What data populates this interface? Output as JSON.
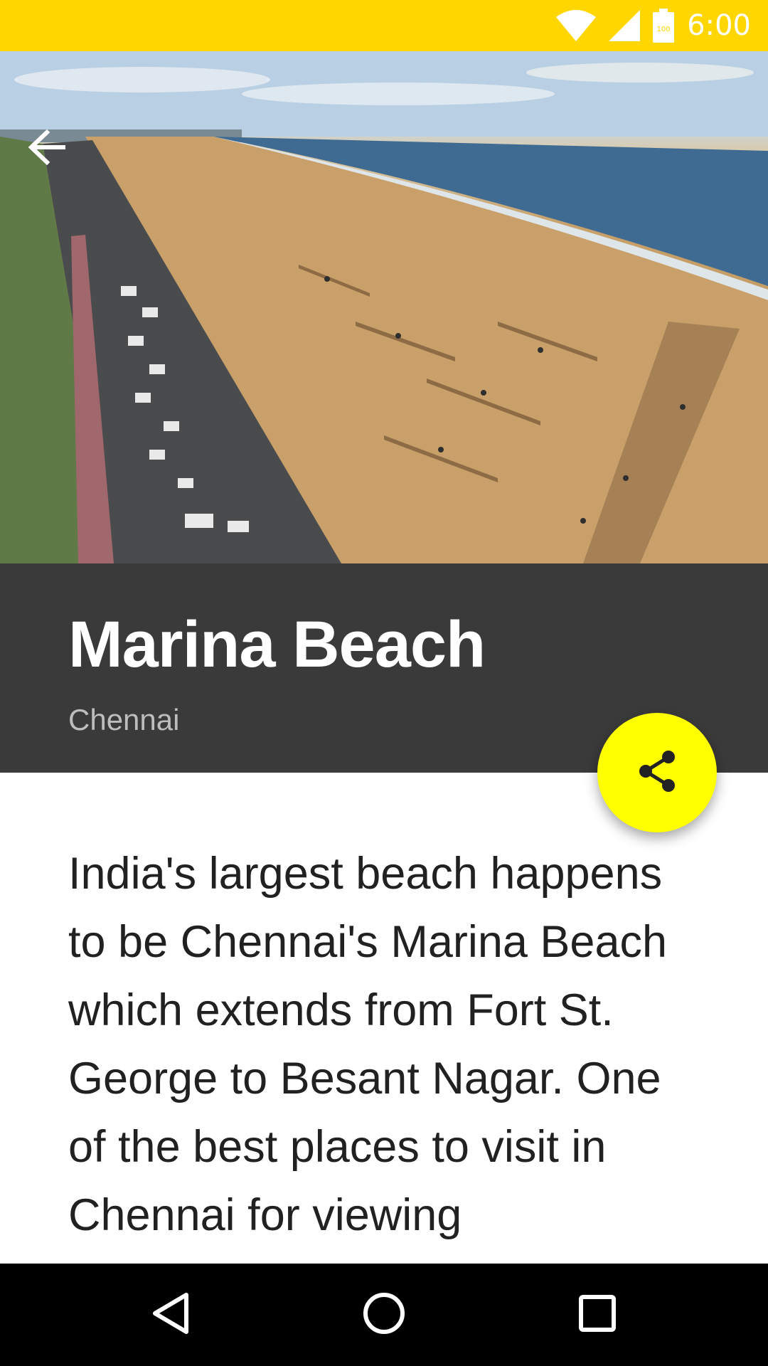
{
  "status_bar": {
    "time": "6:00",
    "battery_level": "100",
    "background_color": "#FFD600",
    "icons": [
      "wifi-icon",
      "cellular-signal-icon",
      "battery-icon"
    ]
  },
  "toolbar": {
    "back_icon": "arrow-back-icon"
  },
  "place": {
    "title": "Marina Beach",
    "city": "Chennai",
    "description": "India's largest beach happens to be Chennai's Marina Beach which extends from Fort St. George to Besant Nagar. One of the best places to visit in Chennai for viewing"
  },
  "fab": {
    "icon": "share-icon",
    "color": "#FFFF00"
  },
  "nav_bar": {
    "buttons": [
      "back-triangle-icon",
      "home-circle-icon",
      "recents-square-icon"
    ]
  }
}
